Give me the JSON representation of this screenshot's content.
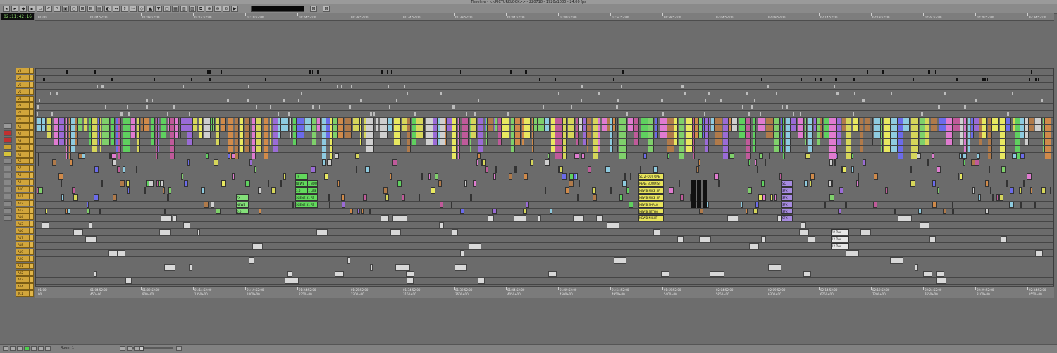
{
  "window": {
    "title": "Timeline - <<PICTURELOCK>> - 220718 - 1920x1080 - 24.00 fps"
  },
  "timecode": {
    "current": "02:11:42:16"
  },
  "ruler": {
    "top_labels": [
      "01:00",
      "01:04:52:00",
      "01:09:52:00",
      "01:14:52:00",
      "01:19:52:00",
      "01:24:52:00",
      "01:29:52:00",
      "01:34:52:00",
      "01:39:52:00",
      "01:44:52:00",
      "01:49:52:00",
      "01:54:52:00",
      "01:59:52:00",
      "02:04:52:00",
      "02:09:52:00",
      "02:14:52:00",
      "02:19:52:00",
      "02:24:52:00",
      "02:29:52:00",
      "02:34:52:00"
    ],
    "bottom_labels": [
      "01:00",
      "01:04:52:00",
      "01:09:52:00",
      "01:14:52:00",
      "01:19:52:00",
      "01:24:52:00",
      "01:29:52:00",
      "01:34:52:00",
      "01:39:52:00",
      "01:44:52:00",
      "01:49:52:00",
      "01:54:52:00",
      "01:59:52:00",
      "02:04:52:00",
      "02:09:52:00",
      "02:14:52:00",
      "02:19:52:00",
      "02:24:52:00",
      "02:29:52:00",
      "02:34:52:00"
    ],
    "feet_labels": [
      "00",
      "450+00",
      "900+00",
      "1350+00",
      "1800+00",
      "2250+00",
      "2700+00",
      "3150+00",
      "3600+00",
      "4050+00",
      "4500+00",
      "4950+00",
      "5400+00",
      "5850+00",
      "6300+00",
      "6750+00",
      "7200+00",
      "7650+00",
      "8100+00",
      "8550+00"
    ]
  },
  "tracks": [
    "V8",
    "V7",
    "V6",
    "V5",
    "V4",
    "V3",
    "V2",
    "V1",
    "A1",
    "A2",
    "A3",
    "A4",
    "A5",
    "A6",
    "A7",
    "A8",
    "A9",
    "A10",
    "A11",
    "A12",
    "A13",
    "A14",
    "A15",
    "A16",
    "A17",
    "A18",
    "A19",
    "A20",
    "A21",
    "A22",
    "A23",
    "A24",
    "TC1"
  ],
  "clip_labels": {
    "scene_labels": [
      "SCENE 31 BOO",
      "SCENE 31 LESI",
      "SCENE 31 AT",
      "SCENE 31 AT"
    ],
    "tf_labels": [
      "TF",
      "NEWB",
      "3.6"
    ],
    "fx_labels": [
      "FX",
      "NEWB",
      "0.0"
    ],
    "yellow_labels": [
      "SC 2FOUT OPE",
      "RENE BOOM SF",
      "NEWB MIKE SF",
      "NEWB MIKE SF",
      "NEWB SHALO",
      "NEWB SETHO",
      "NEWB NIGHT"
    ],
    "small_labels": [
      "SC",
      "SFX",
      "SFX",
      "SFX",
      "SFX",
      "SFX"
    ],
    "dialogue_labels": [
      "02 Dev",
      "12 Dev",
      "12 Dev"
    ]
  },
  "bottom_bar": {
    "zoom_label": "Room 1"
  },
  "colors": {
    "track_header": "#d1a53b",
    "position_indicator": "#3c3cff",
    "timecode_text": "#8dd86b"
  }
}
